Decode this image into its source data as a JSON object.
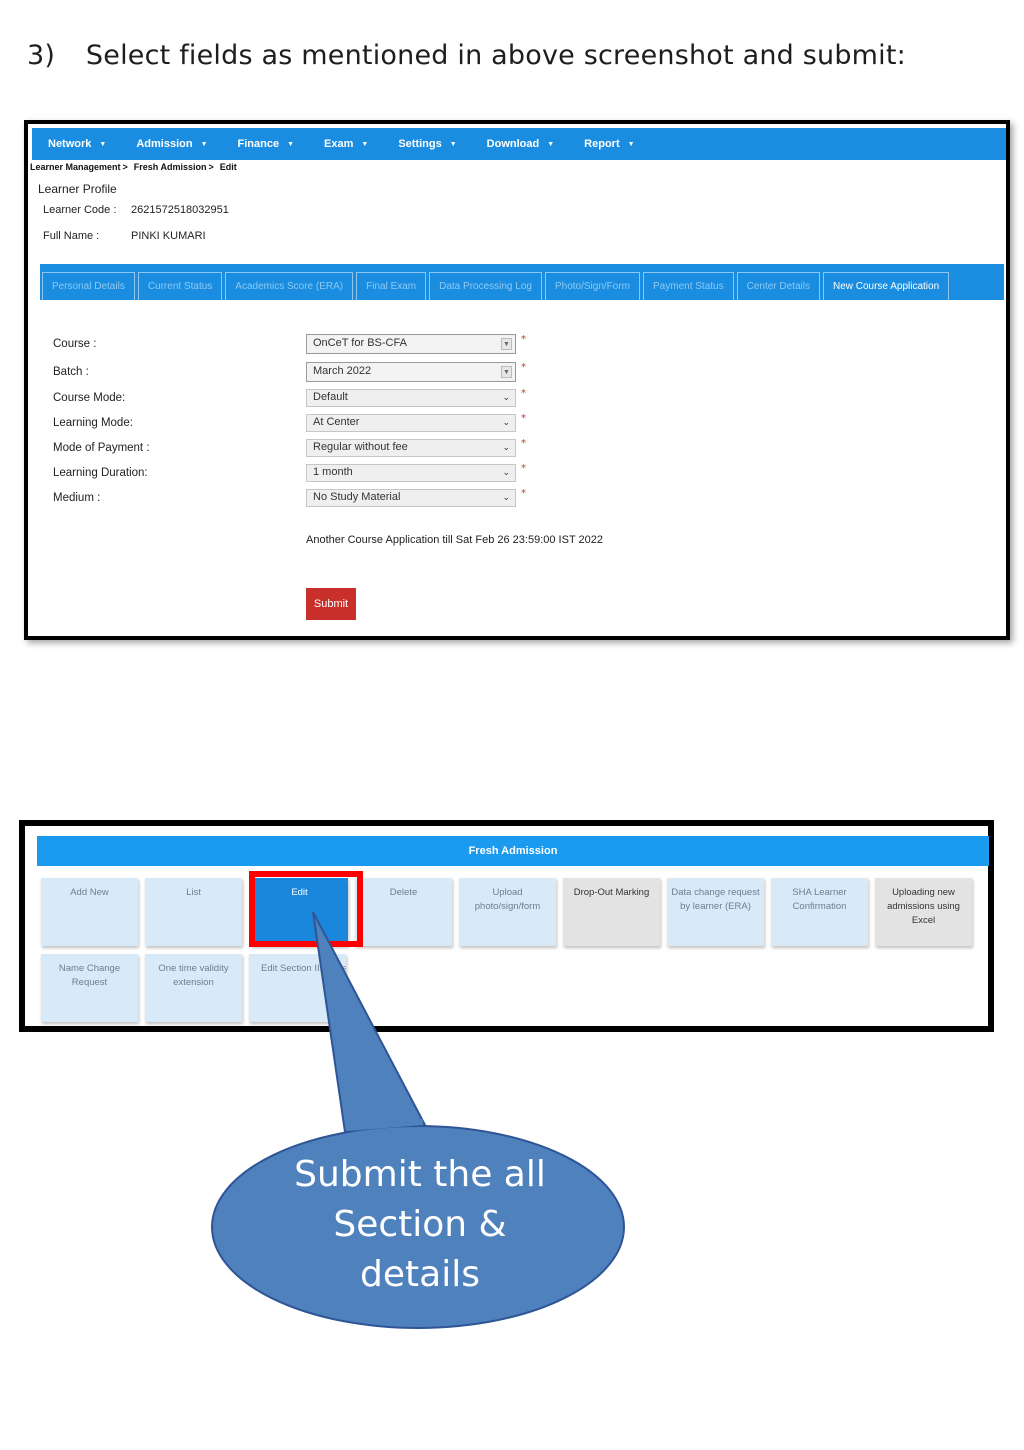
{
  "instruction": {
    "number": "3)",
    "text": "Select fields as mentioned in above screenshot and submit:"
  },
  "navbar": {
    "items": [
      "Network",
      "Admission",
      "Finance",
      "Exam",
      "Settings",
      "Download",
      "Report"
    ]
  },
  "breadcrumb": {
    "items": [
      "Learner Management",
      "Fresh Admission",
      "Edit"
    ],
    "separator": ">"
  },
  "learner_profile": {
    "title": "Learner Profile",
    "code_label": "Learner Code :",
    "code_value": "2621572518032951",
    "name_label": "Full Name :",
    "name_value": "PINKI KUMARI"
  },
  "tabs": [
    "Personal Details",
    "Current Status",
    "Academics Score (ERA)",
    "Final Exam",
    "Data Processing Log",
    "Photo/Sign/Form",
    "Payment Status",
    "Center Details",
    "New Course Application"
  ],
  "form": {
    "fields": [
      {
        "label": "Course :",
        "value": "OnCeT for BS-CFA"
      },
      {
        "label": "Batch :",
        "value": "March 2022"
      },
      {
        "label": "Course Mode:",
        "value": "Default"
      },
      {
        "label": "Learning Mode:",
        "value": "At Center"
      },
      {
        "label": "Mode of Payment :",
        "value": "Regular without fee"
      },
      {
        "label": "Learning Duration:",
        "value": "1 month"
      },
      {
        "label": "Medium :",
        "value": "No Study Material"
      }
    ],
    "required_mark": "*",
    "note": "Another Course Application till Sat Feb 26 23:59:00 IST 2022",
    "submit_label": "Submit"
  },
  "fresh_admission": {
    "header": "Fresh Admission",
    "tiles": [
      "Add New",
      "List",
      "Edit",
      "Delete",
      "Upload photo/sign/form",
      "Drop-Out Marking",
      "Data change request by learner (ERA)",
      "SHA Learner Confirmation",
      "Uploading new admissions using Excel",
      "Name Change Request",
      "One time validity extension",
      "Edit Section II Activation Co"
    ]
  },
  "callout": {
    "lines": [
      "Submit the all",
      "Section &",
      "details"
    ]
  },
  "colors": {
    "nav_blue": "#1a8de0",
    "submit_red": "#c9302c",
    "highlight_red": "#ff0000",
    "callout_fill": "#4f81bd"
  }
}
